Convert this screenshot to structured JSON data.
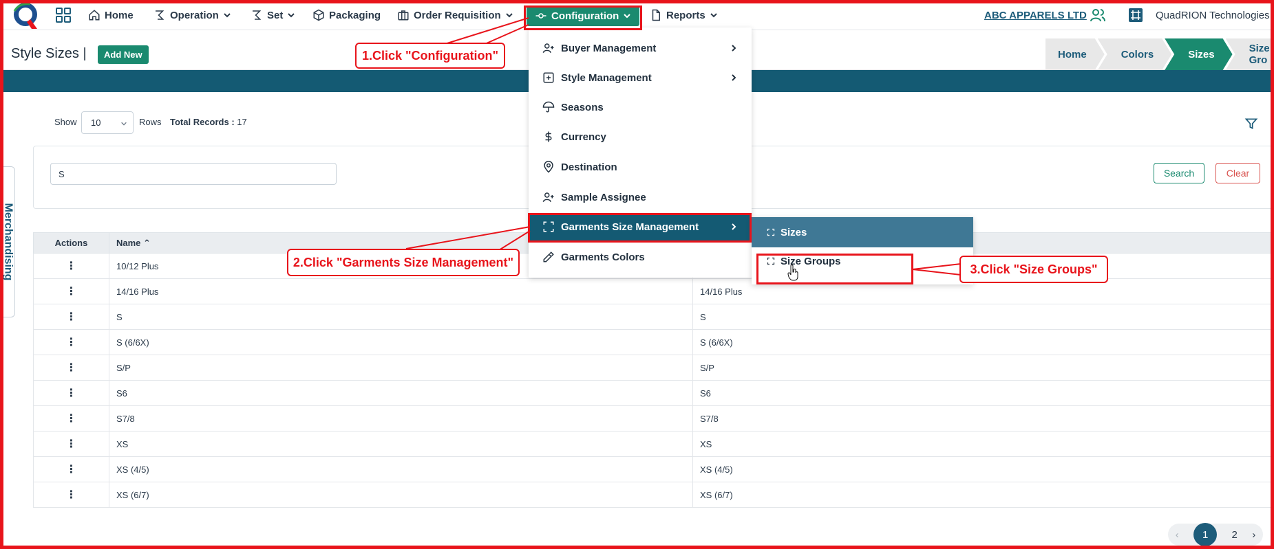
{
  "topnav": {
    "home": "Home",
    "operation": "Operation",
    "set": "Set",
    "packaging": "Packaging",
    "order_requisition": "Order Requisition",
    "configuration": "Configuration",
    "reports": "Reports",
    "company": "ABC APPARELS LTD",
    "org": "QuadRION Technologies"
  },
  "page": {
    "title": "Style Sizes |",
    "add_new": "Add New",
    "breadcrumbs": [
      "Home",
      "Colors",
      "Sizes",
      "Size Gro"
    ],
    "side_tab": "Merchandising"
  },
  "toolbar": {
    "show": "Show",
    "rows_value": "10",
    "rows": "Rows",
    "total_label": "Total Records :",
    "total_value": "17"
  },
  "search": {
    "value": "S",
    "search_btn": "Search",
    "clear_btn": "Clear"
  },
  "table": {
    "headers": [
      "Actions",
      "Name"
    ],
    "rows": [
      [
        "10/12 Plus",
        ""
      ],
      [
        "14/16 Plus",
        "14/16 Plus"
      ],
      [
        "S",
        "S"
      ],
      [
        "S (6/6X)",
        "S (6/6X)"
      ],
      [
        "S/P",
        "S/P"
      ],
      [
        "S6",
        "S6"
      ],
      [
        "S7/8",
        "S7/8"
      ],
      [
        "XS",
        "XS"
      ],
      [
        "XS (4/5)",
        "XS (4/5)"
      ],
      [
        "XS (6/7)",
        "XS (6/7)"
      ]
    ]
  },
  "pagination": {
    "prev": "‹",
    "page1": "1",
    "page2": "2",
    "next": "›"
  },
  "config_menu": {
    "items": [
      "Buyer Management",
      "Style Management",
      "Seasons",
      "Currency",
      "Destination",
      "Sample Assignee",
      "Garments Size Management",
      "Garments Colors"
    ]
  },
  "size_submenu": {
    "sizes": "Sizes",
    "size_groups": "Size Groups"
  },
  "annotations": {
    "step1": "1.Click \"Configuration\"",
    "step2": "2.Click \"Garments Size Management\"",
    "step3": "3.Click \"Size Groups\""
  },
  "colors": {
    "accent": "#1a8a6f",
    "band": "#145a73",
    "annotation": "#e8141b"
  }
}
